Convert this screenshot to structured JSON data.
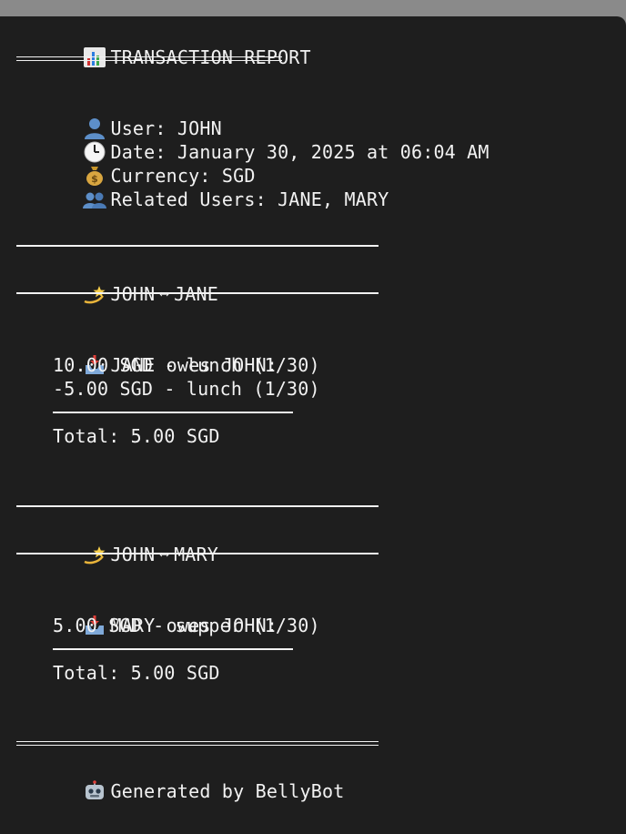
{
  "report": {
    "title": "TRANSACTION REPORT",
    "user_label": "User: JOHN",
    "date_label": "Date: January 30, 2025 at 06:04 AM",
    "currency_label": "Currency: SGD",
    "related_label": "Related Users: JANE, MARY"
  },
  "sections": [
    {
      "left": "JOHN",
      "arrow": "⟷",
      "right": "JANE",
      "owes": "JANE owes JOHN:",
      "items": [
        "10.00 SGD - lunch (1/30)",
        "-5.00 SGD - lunch (1/30)"
      ],
      "total": "Total: 5.00 SGD"
    },
    {
      "left": "JOHN",
      "arrow": "⟷",
      "right": "MARY",
      "owes": "MARY owes JOHN:",
      "items": [
        "5.00 SGD - supper (1/30)"
      ],
      "total": "Total: 5.00 SGD"
    }
  ],
  "footer": {
    "generated": "Generated by BellyBot"
  },
  "icons": {
    "title": "bar-chart-icon",
    "user": "user-icon",
    "date": "clock-icon",
    "currency": "money-bag-icon",
    "related": "users-icon",
    "section": "dizzy-star-icon",
    "owes": "inbox-tray-icon",
    "footer": "robot-icon"
  }
}
